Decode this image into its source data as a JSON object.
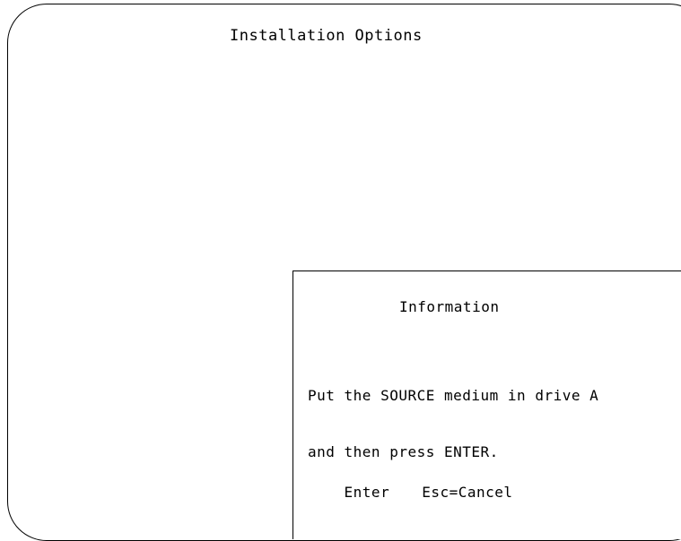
{
  "screen": {
    "title": "Installation Options"
  },
  "dialog": {
    "title": "Information",
    "message_lines": [
      "Put the SOURCE medium in drive A",
      "and then press ENTER."
    ],
    "keys": {
      "enter_label": "Enter",
      "cancel_label": "Esc=Cancel"
    }
  }
}
